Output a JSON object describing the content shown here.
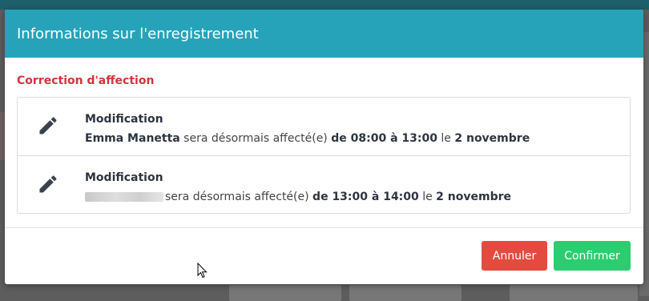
{
  "dialog": {
    "title": "Informations sur l'enregistrement",
    "section_title": "Correction d'affection",
    "items": [
      {
        "heading": "Modification",
        "name": "Emma Manetta",
        "middle": " sera désormais affecté(e) ",
        "time_range": "de 08:00 à 13:00",
        "le": " le ",
        "date": "2 novembre",
        "icon": "pencil-icon"
      },
      {
        "heading": "Modification",
        "name": "",
        "middle": "sera désormais affecté(e) ",
        "time_range": "de 13:00 à 14:00",
        "le": " le ",
        "date": "2 novembre",
        "icon": "pencil-icon"
      }
    ],
    "buttons": {
      "cancel": "Annuler",
      "confirm": "Confirmer"
    }
  },
  "colors": {
    "header": "#26a3b9",
    "section_title": "#d0353e",
    "cancel_button": "#e34b3f",
    "confirm_button": "#2ecc71"
  }
}
